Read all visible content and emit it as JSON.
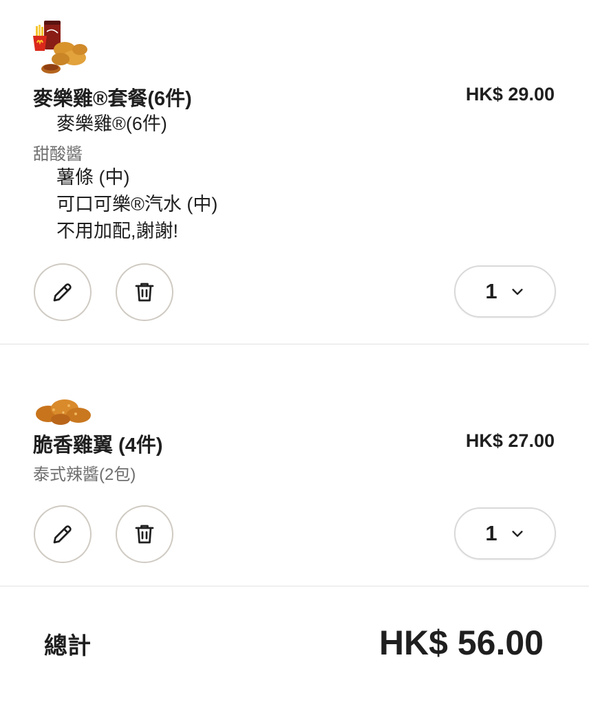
{
  "items": [
    {
      "title": "麥樂雞®套餐(6件)",
      "price": "HK$ 29.00",
      "lines": [
        "麥樂雞®(6件)",
        "甜酸醬",
        "薯條 (中)",
        "可口可樂®汽水 (中)",
        "不用加配,謝謝!"
      ],
      "quantity": "1"
    },
    {
      "title": "脆香雞翼 (4件)",
      "price": "HK$ 27.00",
      "lines": [
        "泰式辣醬(2包)"
      ],
      "quantity": "1"
    }
  ],
  "total": {
    "label": "總計",
    "value": "HK$ 56.00"
  },
  "icons": {
    "edit": "pencil-icon",
    "delete": "trash-icon",
    "dropdown": "chevron-down-icon"
  },
  "colors": {
    "button_border": "#cfcac2",
    "text": "#1f1f1f",
    "muted": "#6f6f6f"
  }
}
